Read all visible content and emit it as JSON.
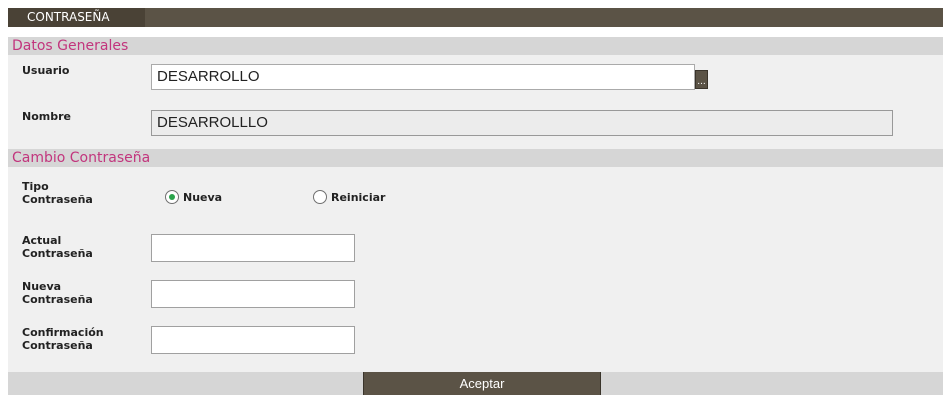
{
  "window": {
    "title": "CONTRASEÑA"
  },
  "datos_generales": {
    "header": "Datos Generales",
    "usuario_label": "Usuario",
    "usuario_value": "DESARROLLO",
    "lookup_label": "...",
    "nombre_label": "Nombre",
    "nombre_value": "DESARROLLLO"
  },
  "cambio": {
    "header": "Cambio Contraseña",
    "tipo_label_1": "Tipo",
    "tipo_label_2": "Contraseña",
    "options": [
      {
        "label": "Nueva",
        "checked": true
      },
      {
        "label": "Reiniciar",
        "checked": false
      }
    ],
    "actual_label_1": "Actual",
    "actual_label_2": "Contraseña",
    "nueva_label_1": "Nueva",
    "nueva_label_2": "Contraseña",
    "confirm_label_1": "Confirmación",
    "confirm_label_2": "Contraseña"
  },
  "footer": {
    "accept_label": "Aceptar"
  },
  "colors": {
    "header_bar": "#5b5346",
    "section_text": "#c2357d",
    "radio_dot": "#2aa34a"
  }
}
